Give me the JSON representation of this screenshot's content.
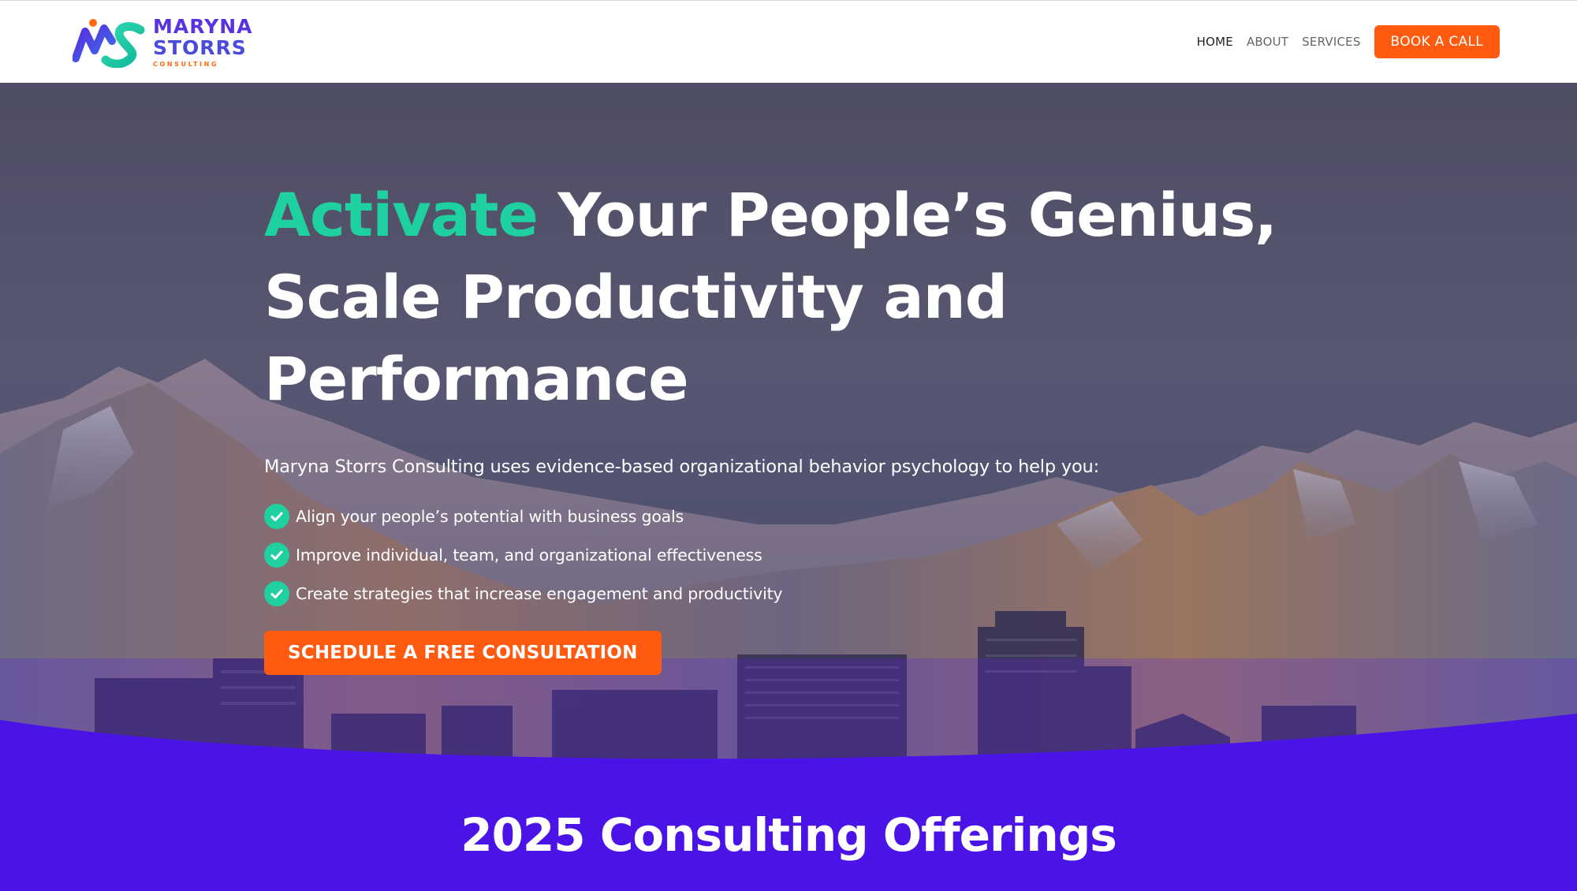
{
  "header": {
    "logo": {
      "line1": "MARYNA",
      "line2": "STORRS",
      "sub": "CONSULTING"
    },
    "nav": [
      {
        "label": "HOME",
        "active": true
      },
      {
        "label": "ABOUT",
        "active": false
      },
      {
        "label": "SERVICES",
        "active": false
      }
    ],
    "cta_label": "BOOK A CALL"
  },
  "hero": {
    "headline_accent": "Activate",
    "headline_rest_1": " Your People’s Genius,",
    "headline_line_2": "Scale Productivity and Performance",
    "intro": "Maryna Storrs Consulting uses evidence-based organizational behavior psychology to help you:",
    "bullets": [
      "Align your people’s potential with business goals",
      "Improve individual, team, and organizational effectiveness",
      "Create strategies that increase engagement and productivity"
    ],
    "cta_label": "SCHEDULE A FREE CONSULTATION"
  },
  "offerings": {
    "title": "2025 Consulting Offerings"
  },
  "colors": {
    "accent_green": "#1fd1a0",
    "accent_orange": "#ff5a10",
    "brand_purple": "#4b14e6"
  },
  "icons": {
    "bullet": "check-circle-icon"
  }
}
